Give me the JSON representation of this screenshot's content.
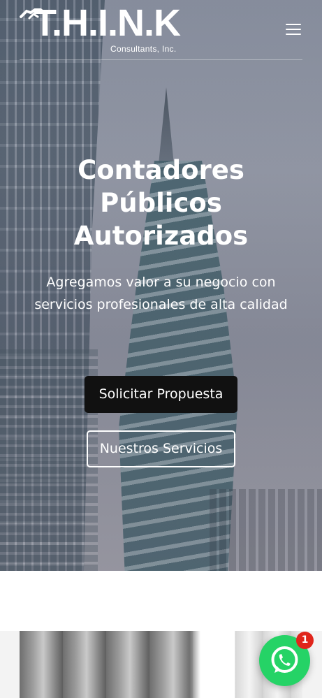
{
  "header": {
    "logo_text": "T.H.I.N.K",
    "logo_subtitle": "Consultants, Inc.",
    "menu_icon": "hamburger-menu-icon"
  },
  "hero": {
    "title": "Contadores Públicos Autorizados",
    "subtitle": "Agregamos valor a su negocio con servicios profesionales de alta calidad",
    "primary_button": "Solicitar Propuesta",
    "secondary_button": "Nuestros Servicios"
  },
  "whatsapp": {
    "icon": "whatsapp-icon",
    "badge_count": "1"
  },
  "colors": {
    "primary_button_bg": "#111111",
    "whatsapp_green": "#25d366",
    "badge_red": "#e0251b"
  }
}
